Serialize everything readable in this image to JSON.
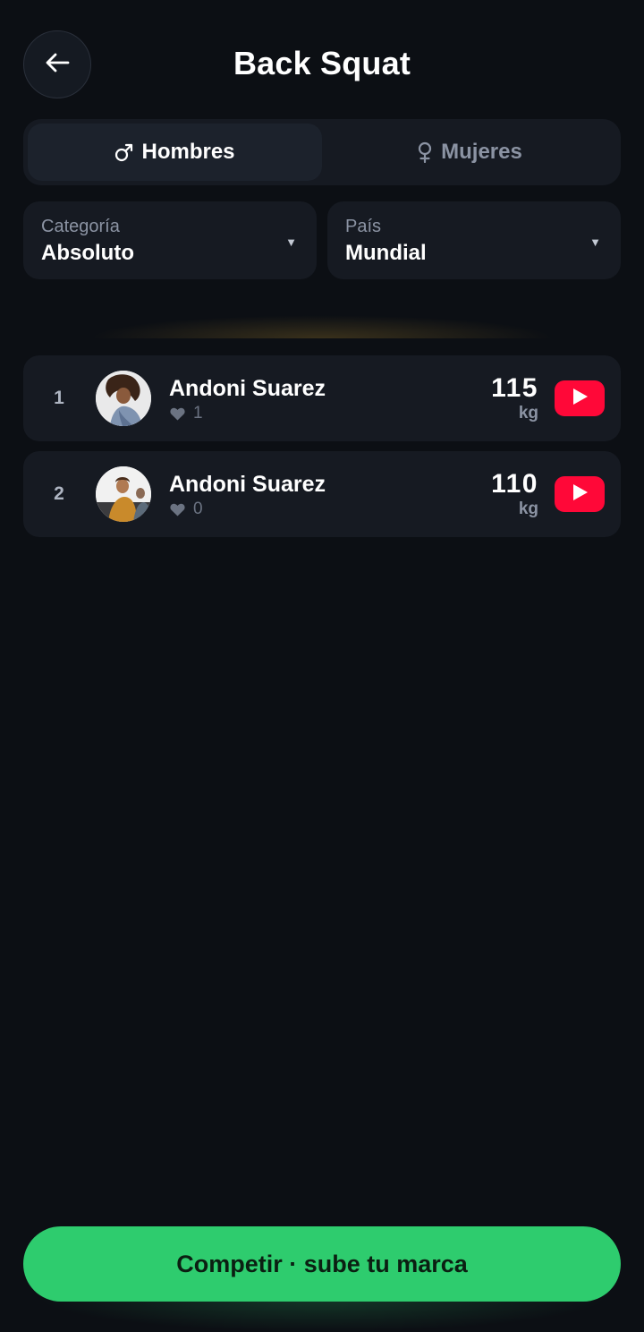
{
  "header": {
    "title": "Back Squat",
    "back_icon": "arrow-left-icon"
  },
  "gender_tabs": [
    {
      "label": "Hombres",
      "icon": "male-icon",
      "active": true
    },
    {
      "label": "Mujeres",
      "icon": "female-icon",
      "active": false
    }
  ],
  "filters": {
    "category": {
      "label": "Categoría",
      "value": "Absoluto"
    },
    "country": {
      "label": "País",
      "value": "Mundial"
    }
  },
  "ranking": [
    {
      "rank": "1",
      "name": "Andoni Suarez",
      "likes": "1",
      "weight": "115",
      "unit": "kg"
    },
    {
      "rank": "2",
      "name": "Andoni Suarez",
      "likes": "0",
      "weight": "110",
      "unit": "kg"
    }
  ],
  "cta": {
    "label": "Competir · sube tu marca"
  },
  "colors": {
    "background": "#0c0f14",
    "card": "#161a22",
    "accent_green": "#2ecc6e",
    "youtube_red": "#ff0838",
    "muted_text": "#8b93a3"
  }
}
